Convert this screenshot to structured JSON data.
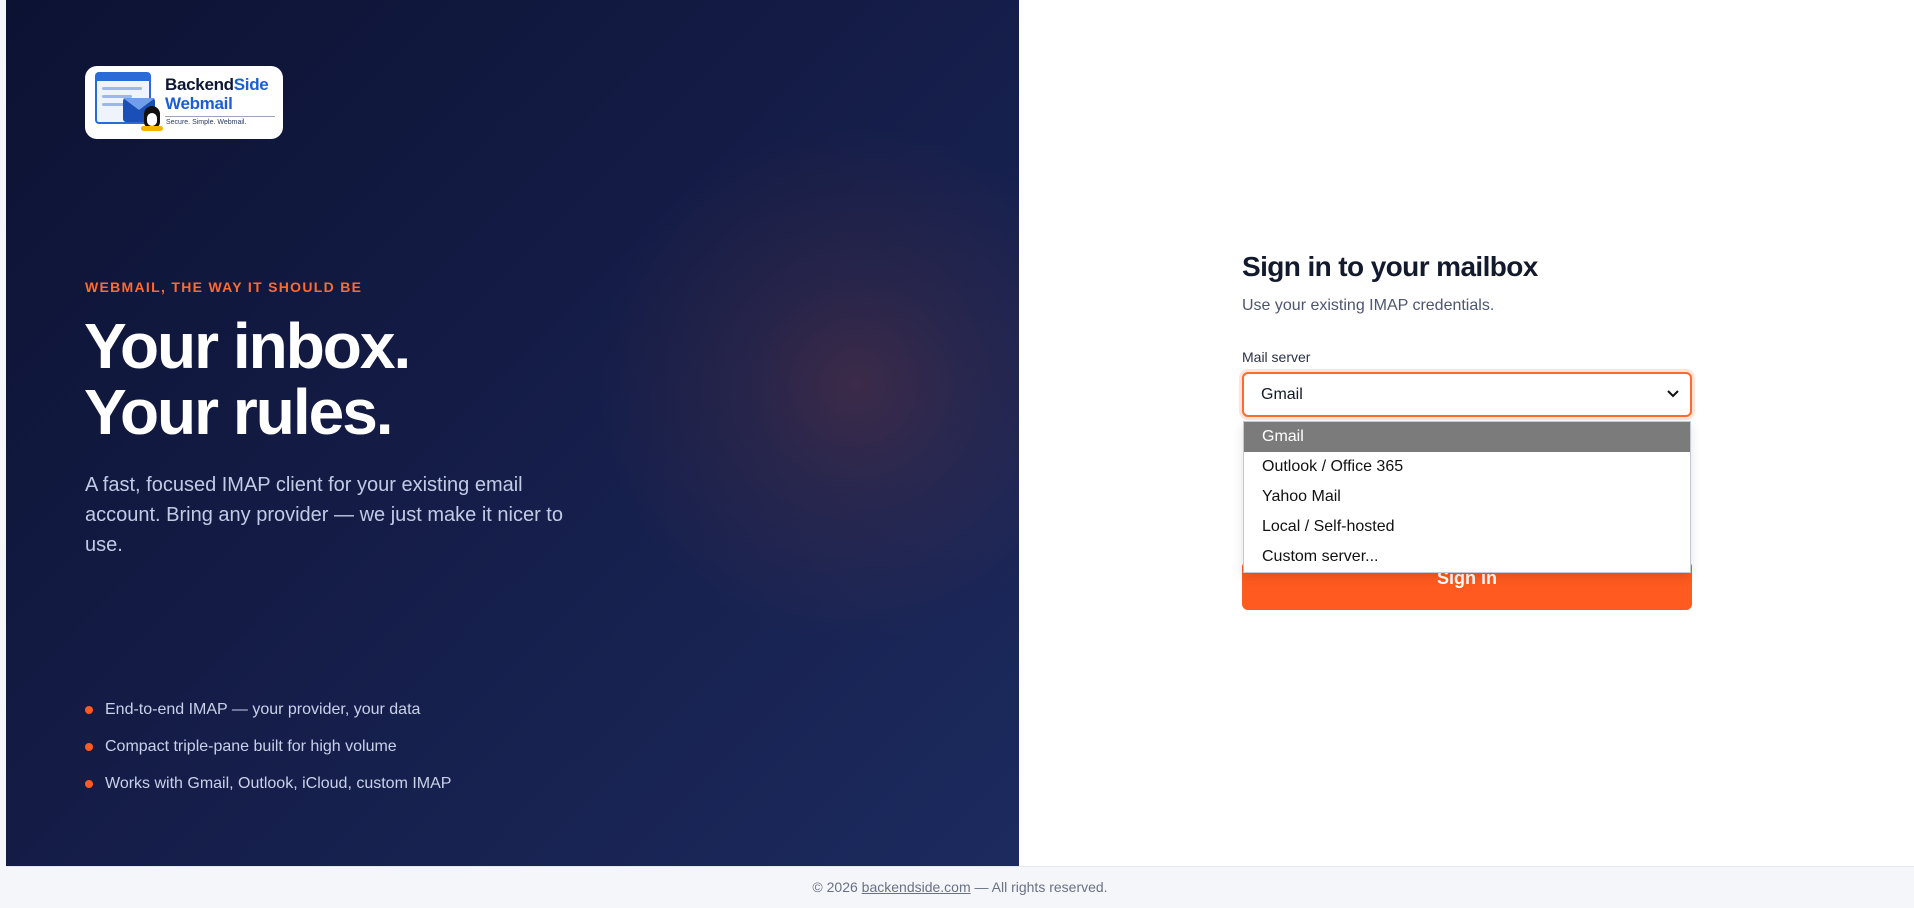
{
  "logo": {
    "brand_a": "Backend",
    "brand_b": "Side",
    "product": "Webmail",
    "tagline": "Secure. Simple. Webmail."
  },
  "hero": {
    "eyebrow": "WEBMAIL, THE WAY IT SHOULD BE",
    "headline_line1": "Your inbox.",
    "headline_line2": "Your rules.",
    "lede": "A fast, focused IMAP client for your existing email account. Bring any provider — we just make it nicer to use.",
    "features": [
      "End-to-end IMAP — your provider, your data",
      "Compact triple-pane built for high volume",
      "Works with Gmail, Outlook, iCloud, custom IMAP"
    ]
  },
  "form": {
    "title": "Sign in to your mailbox",
    "subtitle": "Use your existing IMAP credentials.",
    "server_label": "Mail server",
    "server_value": "Gmail",
    "server_options": [
      "Gmail",
      "Outlook / Office 365",
      "Yahoo Mail",
      "Local / Self-hosted",
      "Custom server..."
    ],
    "signin_label": "Sign in"
  },
  "footer": {
    "prefix": "© 2026 ",
    "link": "backendside.com",
    "suffix": " — All rights reserved."
  },
  "colors": {
    "accent": "#ff5a1f",
    "panel_dark": "#0c1232",
    "panel_light": "#1c2a5e"
  }
}
